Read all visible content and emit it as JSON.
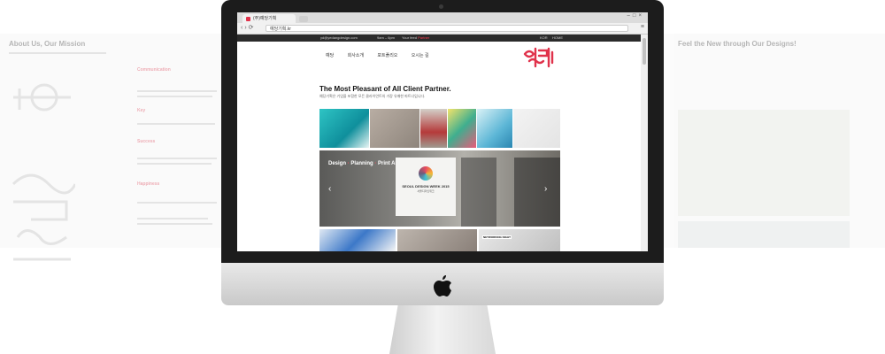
{
  "left_panel": {
    "heading": "About Us, Our Mission",
    "keywords": [
      "Communication",
      "Key",
      "Success",
      "Happiness"
    ]
  },
  "right_panel": {
    "heading": "Feel the New through Our Designs!"
  },
  "browser": {
    "tab_title": "(주)예당기획",
    "url": "예당기획.kr"
  },
  "site": {
    "topbar": {
      "email": "yd@yedangdesign.com",
      "hours": "9am – 6pm",
      "feed_prefix": "Your feed",
      "feed_highlight": "Partner",
      "lang": "KOR",
      "home": "HOME"
    },
    "nav": [
      "예당",
      "회사소개",
      "포트폴리오",
      "오시는 길"
    ],
    "headline": "The Most Pleasant of All Client Partner.",
    "subline": "예당기획은 기업을 포함한 모든 클라이언트의 가장 유쾌한 파트너입니다.",
    "hero": {
      "tag_parts": [
        "Design",
        "Planning",
        "Print AD"
      ],
      "sep": "·",
      "banner_title": "SEOUL DESIGN WEEK 2015",
      "banner_sub": "서울디자인위크"
    },
    "bottom_label": "NETWORKING NIGHT"
  },
  "colors": {
    "accent": "#e0324b",
    "bezel": "#1c1c1c",
    "topbar": "#2b2b2b"
  }
}
